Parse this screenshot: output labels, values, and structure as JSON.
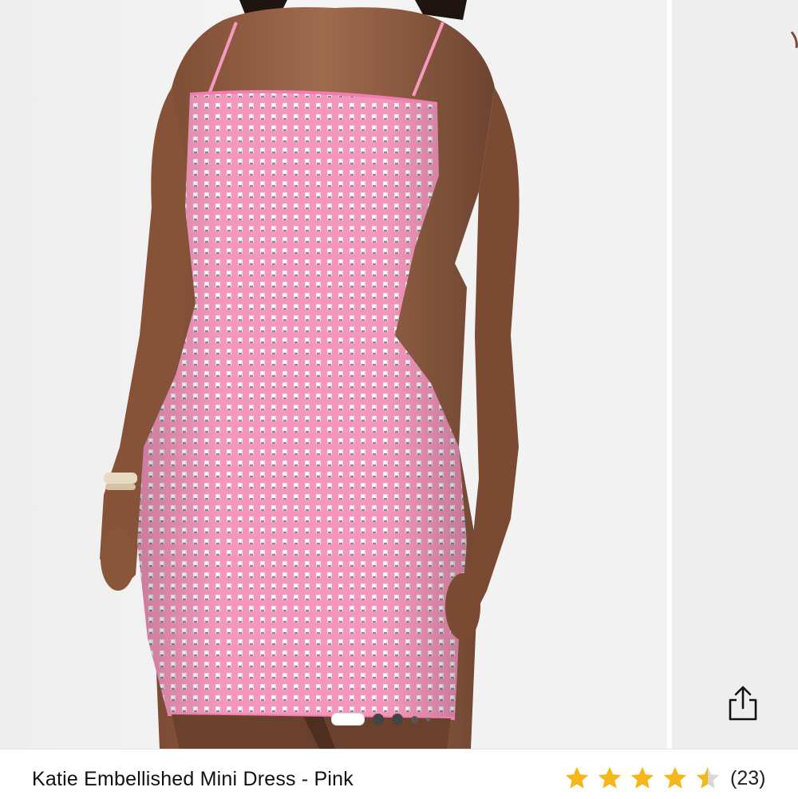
{
  "product": {
    "title": "Katie Embellished Mini Dress - Pink",
    "rating_value": 4.5,
    "rating_max": 5,
    "review_count_label": "(23)"
  },
  "gallery": {
    "image_description": "model wearing pink rhinestone mini dress",
    "slide_count": 6,
    "active_slide": 1
  },
  "icons": {
    "share": "share-icon",
    "star": "star-icon"
  },
  "colors": {
    "dress_pink": "#f59ac0",
    "star_gold": "#f5b71b",
    "star_empty": "#d8d8d8"
  }
}
